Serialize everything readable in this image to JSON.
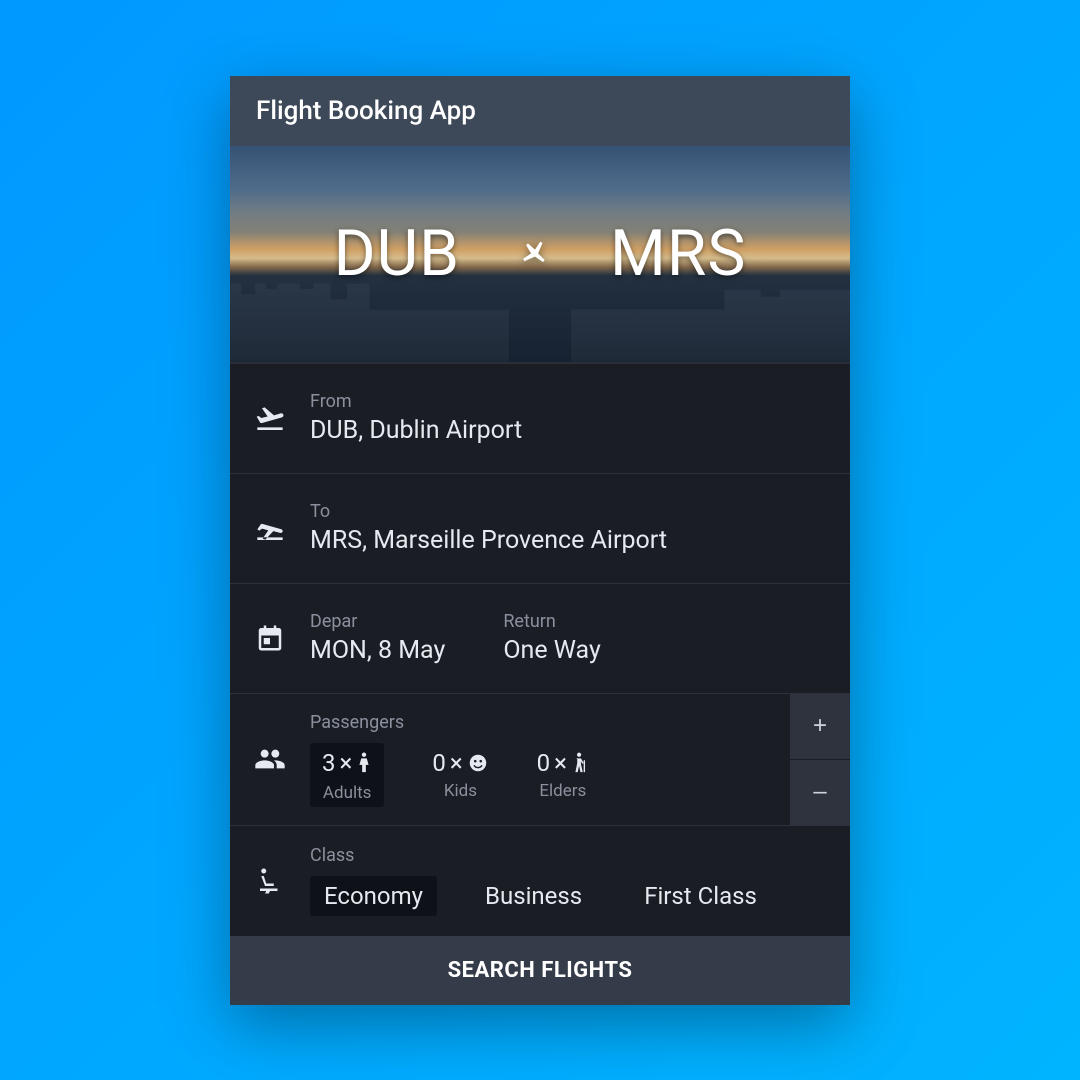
{
  "header": {
    "title": "Flight Booking App"
  },
  "hero": {
    "origin_code": "DUB",
    "destination_code": "MRS"
  },
  "from": {
    "label": "From",
    "value": "DUB, Dublin Airport"
  },
  "to": {
    "label": "To",
    "value": "MRS, Marseille Provence Airport"
  },
  "dates": {
    "depart_label": "Depar",
    "depart_value": "MON, 8 May",
    "return_label": "Return",
    "return_value": "One Way"
  },
  "passengers": {
    "label": "Passengers",
    "adults": {
      "count": "3",
      "x": "×",
      "sub": "Adults"
    },
    "kids": {
      "count": "0",
      "x": "×",
      "sub": "Kids"
    },
    "elders": {
      "count": "0",
      "x": "×",
      "sub": "Elders"
    },
    "plus": "+",
    "minus": "–"
  },
  "klass": {
    "label": "Class",
    "options": [
      "Economy",
      "Business",
      "First Class"
    ],
    "selected": "Economy"
  },
  "search": {
    "label": "SEARCH FLIGHTS"
  }
}
